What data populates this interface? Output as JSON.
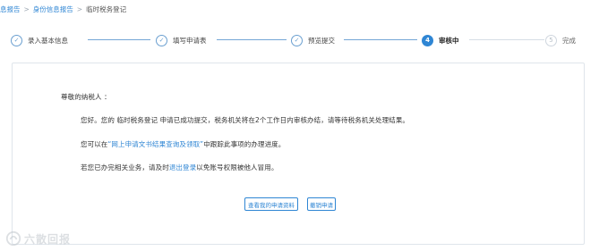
{
  "breadcrumb": {
    "items": [
      "息报告",
      "身份信息报告",
      "临时税务登记"
    ]
  },
  "steps": [
    {
      "num": "",
      "label": "录入基本信息",
      "state": "done"
    },
    {
      "num": "",
      "label": "填写申请表",
      "state": "done"
    },
    {
      "num": "",
      "label": "预览提交",
      "state": "done"
    },
    {
      "num": "4",
      "label": "审核中",
      "state": "active"
    },
    {
      "num": "5",
      "label": "完成",
      "state": "todo"
    }
  ],
  "message": {
    "greeting": "尊敬的纳税人 ：",
    "line1": "您好。您的 临时税务登记 申请已成功提交，税务机关将在2个工作日内审核办结，请等待税务机关处理结果。",
    "line2_prefix": "您可以在",
    "line2_link": "“网上申请文书结果查询及领取”",
    "line2_suffix": "中跟踪此事项的办理进度。",
    "line3_prefix": "若您已办完相关业务，请及时",
    "line3_link": "退出登录",
    "line3_suffix": "以免账号权限被他人冒用。"
  },
  "buttons": {
    "view": "查看我的申请资料",
    "withdraw": "撤销申请"
  },
  "watermark": {
    "text": "六散回报",
    "icon": "watermark-logo-icon"
  },
  "colors": {
    "accent": "#2f86d4",
    "done_line": "#74a6d6",
    "todo_line": "#d6dde5",
    "panel_border": "#dfe5eb"
  }
}
